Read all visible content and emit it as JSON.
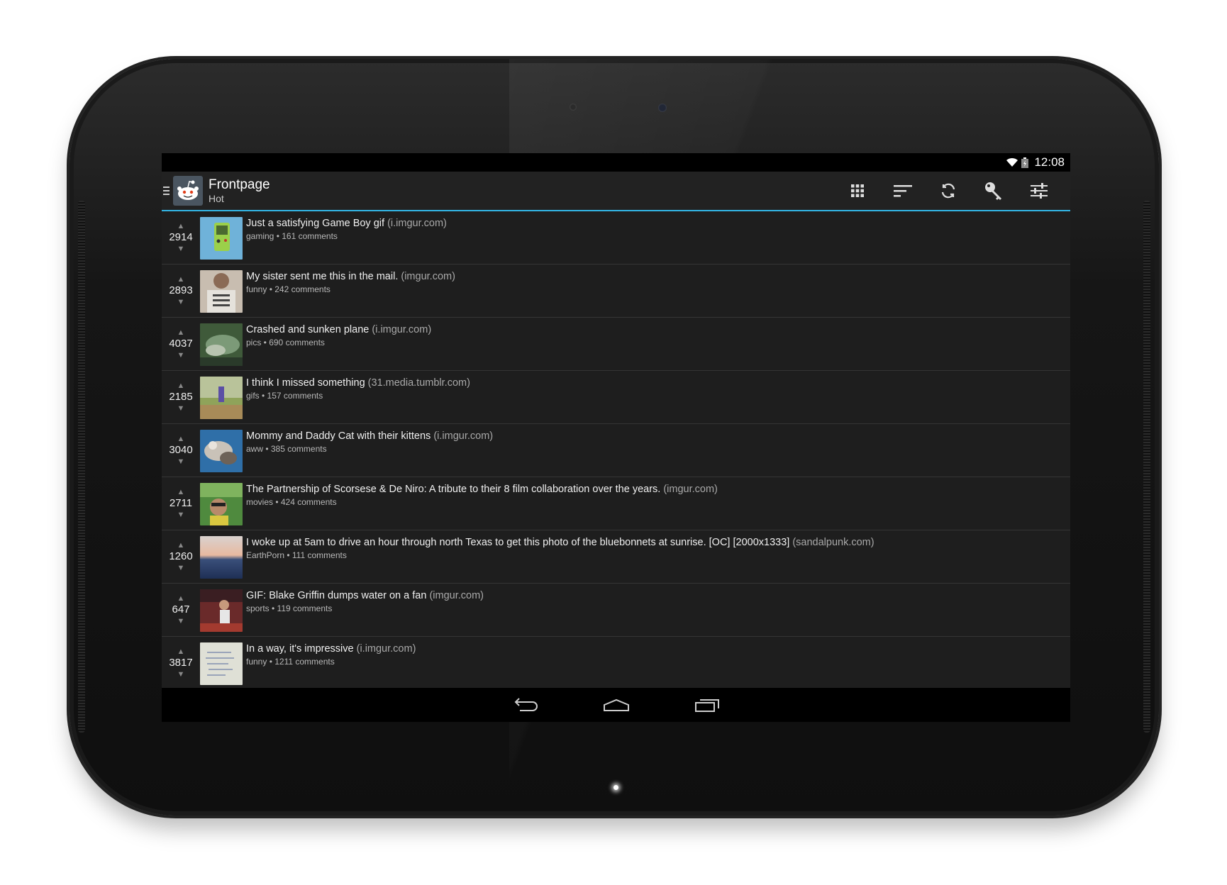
{
  "status": {
    "time": "12:08",
    "icons": [
      "wifi-icon",
      "battery-icon"
    ]
  },
  "actionbar": {
    "title": "Frontpage",
    "subtitle": "Hot",
    "actions": [
      "grid-icon",
      "sort-icon",
      "refresh-icon",
      "key-icon",
      "settings-sliders-icon"
    ]
  },
  "posts": [
    {
      "score": "2914",
      "title": "Just a satisfying Game Boy gif",
      "domain": "(i.imgur.com)",
      "meta": "gaming • 161 comments"
    },
    {
      "score": "2893",
      "title": "My sister sent me this in the mail.",
      "domain": "(imgur.com)",
      "meta": "funny • 242 comments"
    },
    {
      "score": "4037",
      "title": "Crashed and sunken plane",
      "domain": "(i.imgur.com)",
      "meta": "pics • 690 comments"
    },
    {
      "score": "2185",
      "title": "I think I missed something",
      "domain": "(31.media.tumblr.com)",
      "meta": "gifs • 157 comments"
    },
    {
      "score": "3040",
      "title": "Mommy and Daddy Cat with their kittens",
      "domain": "(i.imgur.com)",
      "meta": "aww • 385 comments"
    },
    {
      "score": "2711",
      "title": "The Partnership of Scorsese & De Niro: A tribute to their 8 film collaboration over the years.",
      "domain": "(imgur.com)",
      "meta": "movies • 424 comments"
    },
    {
      "score": "1260",
      "title": "I woke up at 5am to drive an hour through north Texas to get this photo of the bluebonnets at sunrise. [OC] [2000x1333]",
      "domain": "(sandalpunk.com)",
      "meta": "EarthPorn • 111 comments"
    },
    {
      "score": "647",
      "title": "GIF: Blake Griffin dumps water on a fan",
      "domain": "(imgur.com)",
      "meta": "sports • 119 comments"
    },
    {
      "score": "3817",
      "title": "In a way, it's impressive",
      "domain": "(i.imgur.com)",
      "meta": "funny • 1211 comments"
    }
  ],
  "navbar": [
    "back-icon",
    "home-icon",
    "recents-icon"
  ],
  "colors": {
    "accent": "#33b5e5",
    "background": "#1e1e1e",
    "actionbar": "#222222"
  }
}
